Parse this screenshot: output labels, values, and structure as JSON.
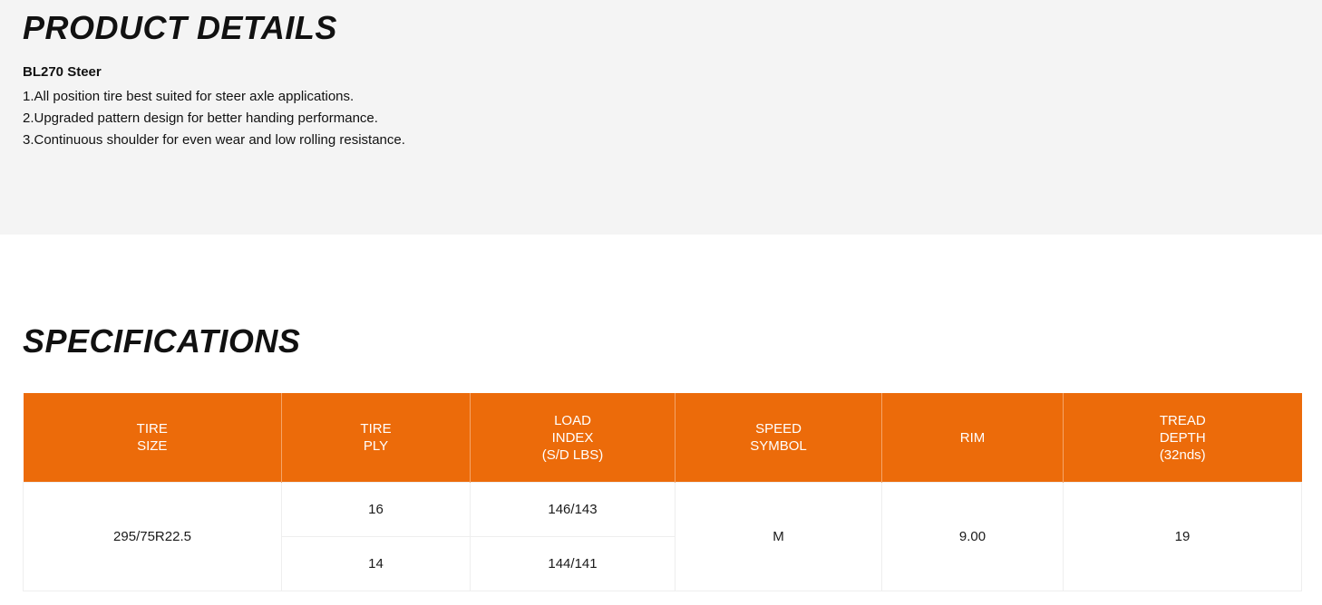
{
  "product_details": {
    "title": "PRODUCT DETAILS",
    "product_name": "BL270 Steer",
    "features": [
      "1.All position tire best suited for steer axle applications.",
      "2.Upgraded pattern design for better handing performance.",
      "3.Continuous shoulder for even wear and low  rolling resistance."
    ]
  },
  "specifications": {
    "title": "SPECIFICATIONS",
    "header_color": "#ec6b0a",
    "headers": [
      {
        "lines": [
          "TIRE",
          "SIZE"
        ]
      },
      {
        "lines": [
          "TIRE",
          "PLY"
        ]
      },
      {
        "lines": [
          "LOAD",
          "INDEX",
          "(S/D LBS)"
        ]
      },
      {
        "lines": [
          "SPEED",
          "SYMBOL"
        ]
      },
      {
        "lines": [
          "RIM"
        ]
      },
      {
        "lines": [
          "TREAD",
          "DEPTH",
          "(32nds)"
        ]
      }
    ],
    "tire_size": "295/75R22.5",
    "variants": [
      {
        "ply": "16",
        "load_index": "146/143"
      },
      {
        "ply": "14",
        "load_index": "144/141"
      }
    ],
    "speed_symbol": "M",
    "rim": "9.00",
    "tread_depth": "19"
  }
}
